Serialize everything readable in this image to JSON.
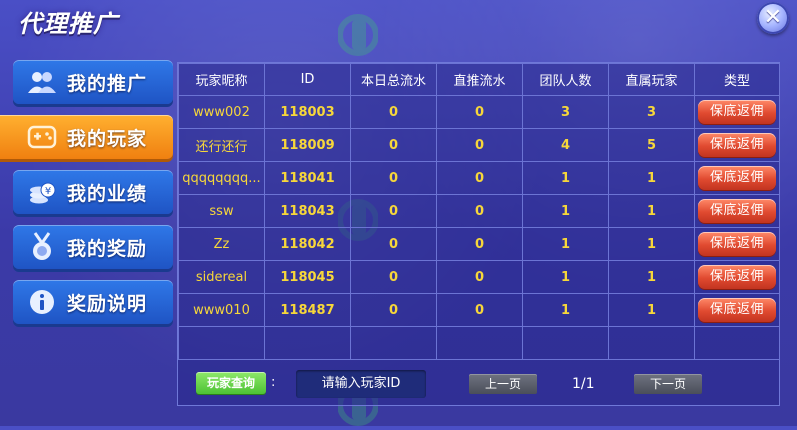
{
  "window": {
    "title": "代理推广",
    "close_symbol": "✕"
  },
  "sidebar": {
    "items": [
      {
        "label": "我的推广",
        "icon": "users-icon"
      },
      {
        "label": "我的玩家",
        "icon": "gamepad-icon"
      },
      {
        "label": "我的业绩",
        "icon": "coins-icon"
      },
      {
        "label": "我的奖励",
        "icon": "medal-icon"
      },
      {
        "label": "奖励说明",
        "icon": "info-icon"
      }
    ],
    "active_index": 1
  },
  "table": {
    "headers": [
      "玩家昵称",
      "ID",
      "本日总流水",
      "直推流水",
      "团队人数",
      "直属玩家",
      "类型"
    ],
    "rows": [
      {
        "name": "www002",
        "id": "118003",
        "daily_flow": "0",
        "direct_flow": "0",
        "team_size": "3",
        "direct_players": "3",
        "type_label": "保底返佣"
      },
      {
        "name": "还行还行",
        "id": "118009",
        "daily_flow": "0",
        "direct_flow": "0",
        "team_size": "4",
        "direct_players": "5",
        "type_label": "保底返佣"
      },
      {
        "name": "qqqqqqqq...",
        "id": "118041",
        "daily_flow": "0",
        "direct_flow": "0",
        "team_size": "1",
        "direct_players": "1",
        "type_label": "保底返佣"
      },
      {
        "name": "ssw",
        "id": "118043",
        "daily_flow": "0",
        "direct_flow": "0",
        "team_size": "1",
        "direct_players": "1",
        "type_label": "保底返佣"
      },
      {
        "name": "Zz",
        "id": "118042",
        "daily_flow": "0",
        "direct_flow": "0",
        "team_size": "1",
        "direct_players": "1",
        "type_label": "保底返佣"
      },
      {
        "name": "sidereal",
        "id": "118045",
        "daily_flow": "0",
        "direct_flow": "0",
        "team_size": "1",
        "direct_players": "1",
        "type_label": "保底返佣"
      },
      {
        "name": "www010",
        "id": "118487",
        "daily_flow": "0",
        "direct_flow": "0",
        "team_size": "1",
        "direct_players": "1",
        "type_label": "保底返佣"
      }
    ]
  },
  "footer": {
    "query_label": "玩家查询",
    "colon": ":",
    "input_placeholder": "请输入玩家ID",
    "input_value": "",
    "prev_label": "上一页",
    "page_indicator": "1/1",
    "next_label": "下一页"
  },
  "colors": {
    "background": "#3b3aa8",
    "active_tab": "#f08010",
    "tab": "#1f54c4",
    "cell_text": "#f7d73a",
    "type_button": "#e04a30",
    "query_button": "#4dc234"
  }
}
